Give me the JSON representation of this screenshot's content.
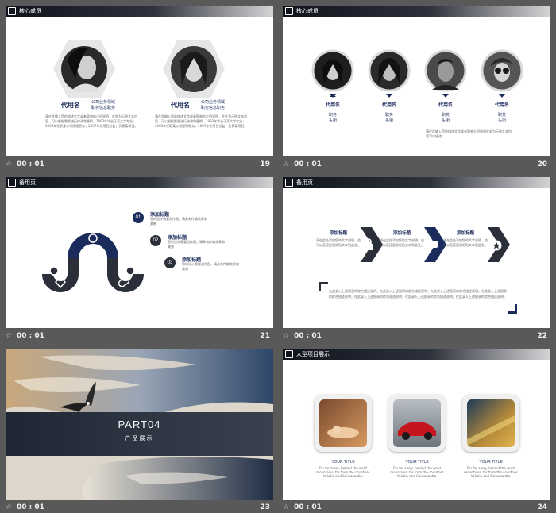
{
  "slides": {
    "s19": {
      "header": "核心成员",
      "time": "00 : 01",
      "num": "19",
      "members": [
        {
          "name": "代用名",
          "role_a": "公司业务领域",
          "role_b": "职务信息职务",
          "desc": "请在此输入您的描述文字或者简单的介绍说明，此处为示例文本内容，可以根据需要进行修改和替换。1993年毕业于某大学专业；2003年任职某公司经理职务；2007年任项目总监，负责某项目。"
        },
        {
          "name": "代用名",
          "role_a": "公司业务领域",
          "role_b": "职务信息职务",
          "desc": "请在此输入您的描述文字或者简单的介绍说明，此处为示例文本内容，可以根据需要进行修改和替换。1993年毕业于某大学专业；2003年任职某公司经理职务；2007年任项目总监，负责某项目。"
        }
      ]
    },
    "s20": {
      "header": "核心成员",
      "time": "00 : 01",
      "num": "20",
      "members": [
        {
          "name": "代用名",
          "job": "职务",
          "title": "头衔"
        },
        {
          "name": "代用名",
          "job": "职务",
          "title": "头衔"
        },
        {
          "name": "代用名",
          "job": "职务",
          "title": "头衔"
        },
        {
          "name": "代用名",
          "job": "职务",
          "title": "头衔"
        }
      ],
      "desc": "请在此输入您的描述文字或者简单介绍说明此处为示例文本内容可以修改"
    },
    "s21": {
      "header": "备用页",
      "time": "00 : 01",
      "num": "21",
      "items": [
        {
          "n": "01",
          "title": "添加标题",
          "text": "您的设计需要创作图，请具有传输效果和美感"
        },
        {
          "n": "02",
          "title": "添加标题",
          "text": "您的设计需要创作图，请具有传输效果和美感"
        },
        {
          "n": "03",
          "title": "添加标题",
          "text": "您的设计需要创作图，请具有传输效果和美感"
        }
      ]
    },
    "s22": {
      "header": "备用页",
      "time": "00 : 01",
      "num": "22",
      "steps": [
        {
          "title": "添加标题",
          "text": "请在此处添加您的文字说明，也可以直接复制粘贴文本到此处。"
        },
        {
          "title": "添加标题",
          "text": "请在此处添加您的文字说明，也可以直接复制粘贴文本到此处。"
        },
        {
          "title": "添加标题",
          "text": "请在此处添加您的文字说明，也可以直接复制粘贴文本到此处。"
        }
      ],
      "body": "在此录入上述图表的综合描述说明，在此录入上述图表的综合描述说明，在此录入上述图表的综合描述说明。在此录入上述图表的综合描述说明，在此录入上述图表的综合描述说明，在此录入上述图表的综合描述说明。在此录入上述图表的综合描述说明。"
    },
    "s23": {
      "time": "00 : 01",
      "num": "23",
      "part": "PART04",
      "subtitle": "产品展示"
    },
    "s24": {
      "header": "大型项目展示",
      "time": "00 : 01",
      "num": "24",
      "items": [
        {
          "title": "YOUR TITLE",
          "text": "Far far away, behind the word mountains, far from the countries Vokalia and Consonantia."
        },
        {
          "title": "YOUR TITLE",
          "text": "Far far away, behind the word mountains, far from the countries Vokalia and Consonantia."
        },
        {
          "title": "YOUR TITLE",
          "text": "Far far away, behind the word mountains, far from the countries Vokalia and Consonantia."
        }
      ]
    }
  },
  "colors": {
    "navy": "#1b2c5c",
    "dark": "#2b2f3a",
    "bg": "#595959"
  }
}
